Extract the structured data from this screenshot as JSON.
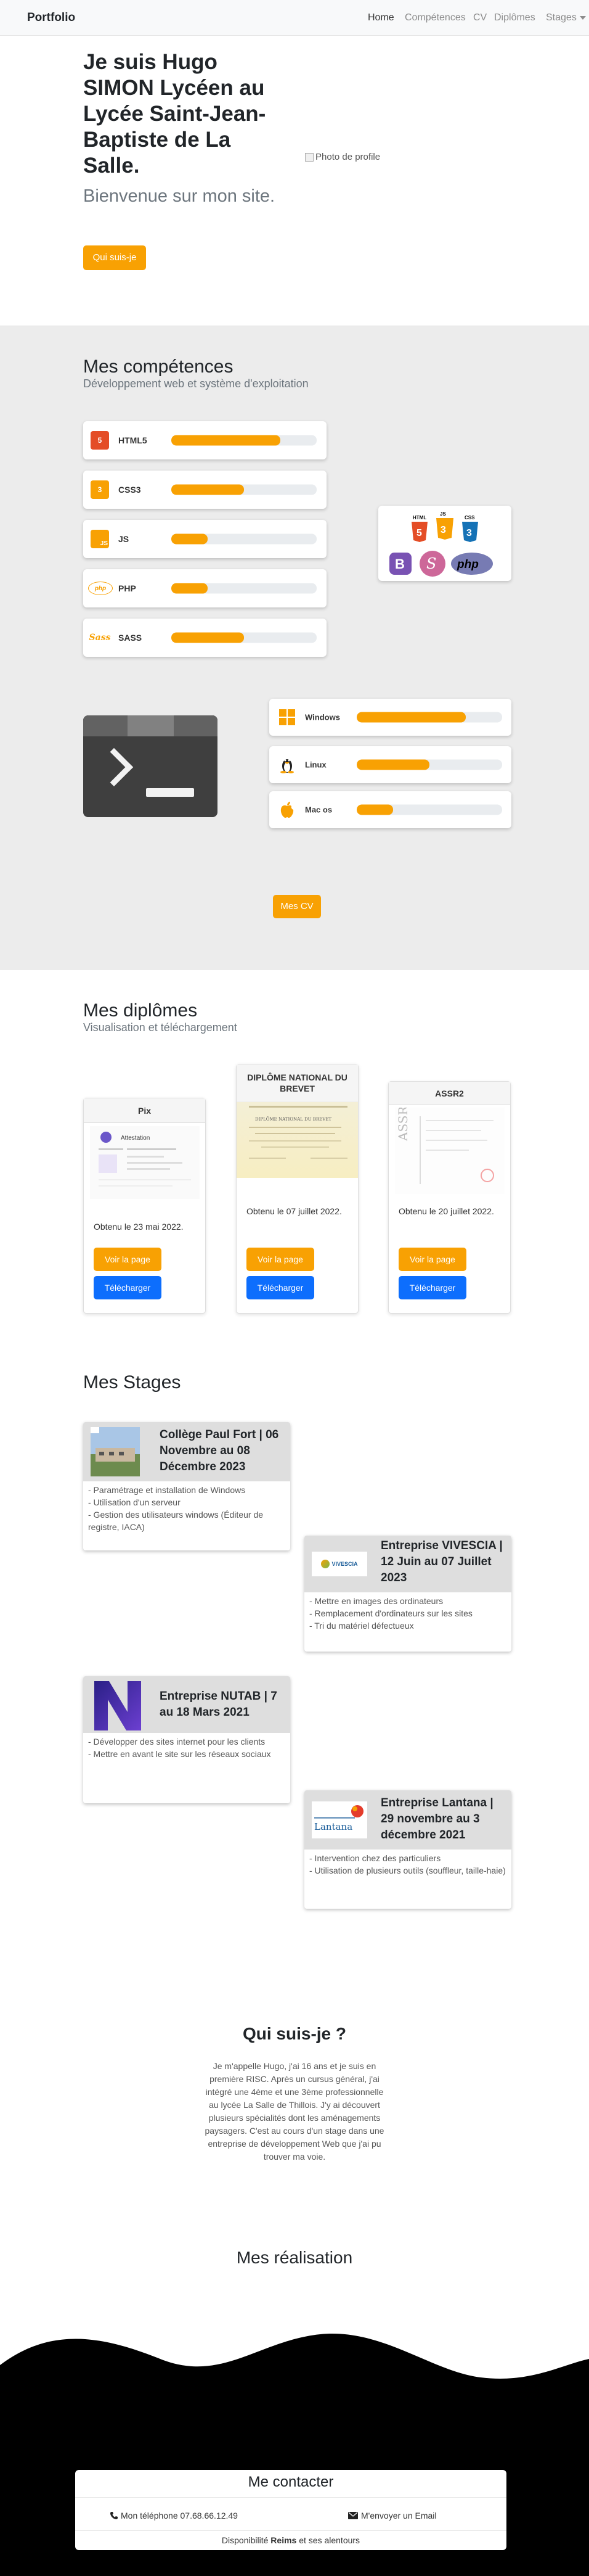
{
  "nav": {
    "brand": "Portfolio",
    "links": [
      "Home",
      "Compétences",
      "CV",
      "Diplômes",
      "Stages"
    ]
  },
  "hero": {
    "title": "Je suis Hugo SIMON Lycéen au Lycée Saint-Jean-Baptiste de La Salle.",
    "subtitle": "Bienvenue sur mon site.",
    "button": "Qui suis-je",
    "image_alt": "Photo de profile"
  },
  "skills": {
    "title": "Mes compétences",
    "subtitle": "Développement web et système d'exploitation",
    "web": [
      {
        "icon": "html5-icon",
        "label": "HTML5",
        "level": 0.75,
        "color": "#e44d26"
      },
      {
        "icon": "css3-icon",
        "label": "CSS3",
        "level": 0.5,
        "color": "#f8a103"
      },
      {
        "icon": "js-icon",
        "label": "JS",
        "level": 0.25,
        "color": "#f8a103"
      },
      {
        "icon": "php-icon",
        "label": "PHP",
        "level": 0.25,
        "color": "#f8a103"
      },
      {
        "icon": "sass-icon",
        "label": "SASS",
        "level": 0.5,
        "color": "#f8a103"
      }
    ],
    "os": [
      {
        "icon": "windows-icon",
        "label": "Windows",
        "level": 0.75
      },
      {
        "icon": "linux-icon",
        "label": "Linux",
        "level": 0.5
      },
      {
        "icon": "apple-icon",
        "label": "Mac os",
        "level": 0.25
      }
    ],
    "logos": {
      "html": "HTML",
      "js": "JS",
      "css": "CSS",
      "php": "php"
    },
    "cv_button": "Mes CV"
  },
  "diplomas": {
    "title": "Mes diplômes",
    "subtitle": "Visualisation et téléchargement",
    "items": [
      {
        "name": "Pix",
        "date": "Obtenu le 23 mai 2022.",
        "view": "Voir la page",
        "download": "Télécharger",
        "preview": "Attestation"
      },
      {
        "name": "DIPLÔME NATIONAL DU BREVET",
        "date": "Obtenu le 07 juillet 2022.",
        "view": "Voir la page",
        "download": "Télécharger",
        "preview": "DIPLÔME NATIONAL DU BREVET"
      },
      {
        "name": "ASSR2",
        "date": "Obtenu le 20 juillet 2022.",
        "view": "Voir la page",
        "download": "Télécharger",
        "preview": "ASSR"
      }
    ]
  },
  "stages": {
    "title": "Mes Stages",
    "items": [
      {
        "title": "Collège Paul Fort | 06 Novembre au 08 Décembre 2023",
        "tasks": [
          "- Paramétrage et installation de Windows",
          "- Utilisation d'un serveur",
          "- Gestion des utilisateurs windows (Éditeur de registre, IACA)"
        ]
      },
      {
        "title": "Entreprise VIVESCIA | 12 Juin au 07 Juillet 2023",
        "logo": "VIVESCIA",
        "tasks": [
          "- Mettre en images des ordinateurs",
          "- Remplacement d'ordinateurs sur les sites",
          "- Tri du matériel défectueux"
        ]
      },
      {
        "title": "Entreprise NUTAB | 7 au 18 Mars 2021",
        "tasks": [
          "- Développer des sites internet pour les clients",
          "- Mettre en avant le site sur les réseaux sociaux"
        ]
      },
      {
        "title": "Entreprise Lantana | 29 novembre au 3 décembre 2021",
        "logo": "Lantana",
        "tasks": [
          "- Intervention chez des particuliers",
          "- Utilisation de plusieurs outils (souffleur, taille-haie)"
        ]
      }
    ]
  },
  "about": {
    "title": "Qui suis-je ?",
    "text": "Je m'appelle Hugo, j'ai 16 ans et je suis en première RISC. Après un cursus général, j'ai intégré une 4ème et une 3ème professionnelle au lycée La Salle de Thillois. J'y ai découvert plusieurs spécialités dont les aménagements paysagers. C'est au cours d'un stage dans une entreprise de développement Web que j'ai pu trouver ma voie."
  },
  "realisations": {
    "title": "Mes réalisation"
  },
  "contact": {
    "title": "Me contacter",
    "phone": "Mon téléphone 07.68.66.12.49",
    "email": "M'envoyer un Email",
    "availability_prefix": "Disponibilité ",
    "availability_city": "Reims",
    "availability_suffix": " et ses alentours"
  }
}
